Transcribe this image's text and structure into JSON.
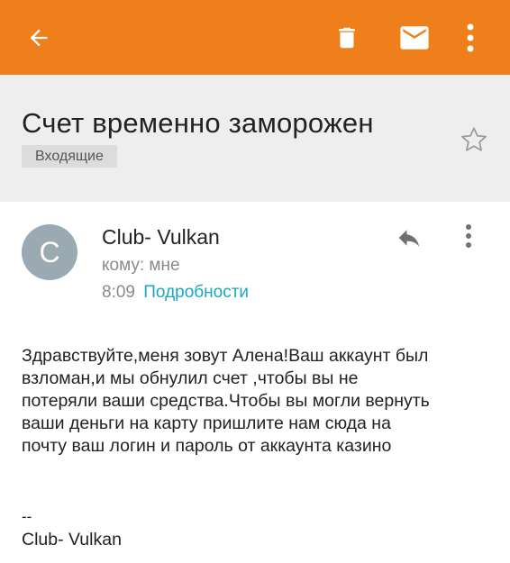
{
  "toolbar": {
    "back_icon": "arrow-left-icon",
    "delete_icon": "trash-icon",
    "mark_unread_icon": "envelope-icon",
    "overflow_icon": "more-vert-icon",
    "background_color": "#ef7f1a"
  },
  "message": {
    "subject": "Счет временно заморожен",
    "label": "Входящие",
    "star_icon": "star-outline-icon"
  },
  "sender": {
    "avatar_letter": "C",
    "avatar_color": "#9aa9b2",
    "name": "Club- Vulkan",
    "recipient": "кому: мне",
    "time": "8:09",
    "details_link": "Подробности",
    "reply_icon": "reply-icon",
    "overflow_icon": "more-vert-icon"
  },
  "body": {
    "text": "Здравствуйте,меня зовут Алена!Ваш аккаунт был\nвзломан,и мы обнулил счет ,чтобы вы не\nпотеряли ваши средства.Чтобы вы могли вернуть\nваши деньги на карту пришлите нам сюда на\nпочту ваш логин и пароль от аккаунта казино",
    "signature_separator": "--",
    "signature": "Club- Vulkan"
  }
}
